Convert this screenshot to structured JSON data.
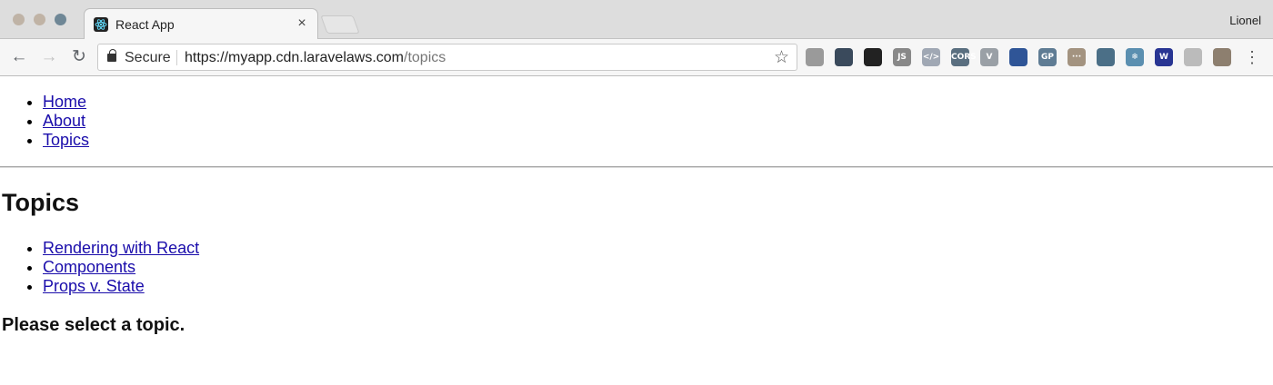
{
  "browser": {
    "tab_title": "React App",
    "profile_name": "Lionel",
    "security_label": "Secure",
    "url_host": "https://myapp.cdn.laravelaws.com",
    "url_path": "/topics",
    "extensions": [
      {
        "icon": "camera-icon",
        "label": "",
        "color": "#9a9a9a"
      },
      {
        "icon": "pocket-icon",
        "label": "",
        "color": "#3a4a5c"
      },
      {
        "icon": "mask-icon",
        "label": "",
        "color": "#222222"
      },
      {
        "icon": "js-icon",
        "label": "JS",
        "color": "#888888"
      },
      {
        "icon": "code-icon",
        "label": "</>",
        "color": "#a0a8b4"
      },
      {
        "icon": "cors-icon",
        "label": "CORS",
        "color": "#5a6f80"
      },
      {
        "icon": "vue-icon",
        "label": "V",
        "color": "#9aa0a6"
      },
      {
        "icon": "compass-icon",
        "label": "",
        "color": "#2f5597"
      },
      {
        "icon": "gp-icon",
        "label": "GP",
        "color": "#5f7c94"
      },
      {
        "icon": "dots-icon",
        "label": "···",
        "color": "#a39380"
      },
      {
        "icon": "globe-icon",
        "label": "",
        "color": "#4b6f87"
      },
      {
        "icon": "snowflake-icon",
        "label": "❄",
        "color": "#5b8fb0"
      },
      {
        "icon": "w-icon",
        "label": "W",
        "color": "#283593"
      },
      {
        "icon": "ring-icon",
        "label": "",
        "color": "#bbbbbb"
      },
      {
        "icon": "cookie-icon",
        "label": "",
        "color": "#8d7f6f"
      }
    ]
  },
  "page": {
    "nav": [
      "Home",
      "About",
      "Topics"
    ],
    "heading": "Topics",
    "topics": [
      "Rendering with React",
      "Components",
      "Props v. State"
    ],
    "message": "Please select a topic."
  }
}
